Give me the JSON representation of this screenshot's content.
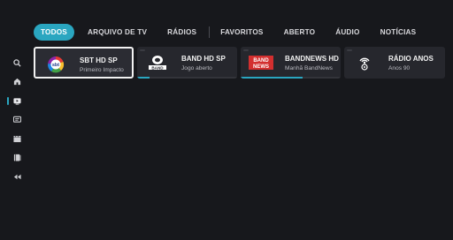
{
  "tabs": [
    {
      "label": "TODOS",
      "active": true
    },
    {
      "label": "ARQUIVO DE TV",
      "active": false
    },
    {
      "label": "RÁDIOS",
      "active": false
    },
    {
      "label": "FAVORITOS",
      "active": false
    },
    {
      "label": "ABERTO",
      "active": false
    },
    {
      "label": "ÁUDIO",
      "active": false
    },
    {
      "label": "NOTÍCIAS",
      "active": false
    }
  ],
  "sidebar": {
    "items": [
      {
        "icon": "search-icon"
      },
      {
        "icon": "home-icon"
      },
      {
        "icon": "live-tv-icon"
      },
      {
        "icon": "guide-icon"
      },
      {
        "icon": "movies-icon"
      },
      {
        "icon": "library-icon"
      },
      {
        "icon": "collapse-icon"
      }
    ]
  },
  "channels": [
    {
      "name": "SBT HD SP",
      "program": "Primeiro Impacto",
      "logo": "sbt",
      "progress": 0.0
    },
    {
      "name": "BAND HD SP",
      "program": "Jogo aberto",
      "logo": "band",
      "progress": 0.12
    },
    {
      "name": "BANDNEWS HD",
      "program": "Manhã BandNews",
      "logo": "bandnews",
      "progress": 0.62
    },
    {
      "name": "RÁDIO ANOS",
      "program": "Anos 90",
      "logo": "radio",
      "progress": 0.0
    }
  ],
  "logo_text": {
    "band": "BAND",
    "bandnews_top": "BAND",
    "bandnews_bottom": "NEWS"
  },
  "colors": {
    "accent": "#2aa6c0",
    "background": "#17181c",
    "card": "#26272d"
  }
}
